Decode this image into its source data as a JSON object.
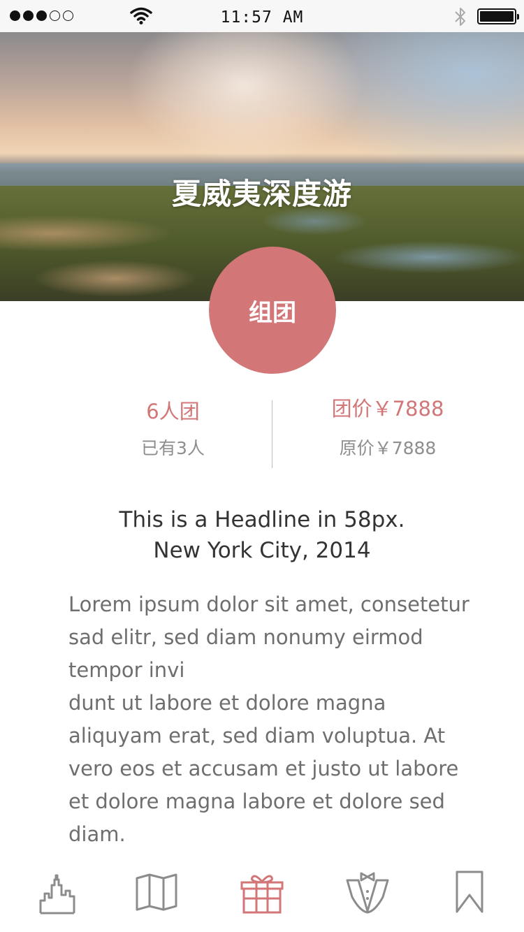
{
  "status_bar": {
    "signal_dots_filled": 3,
    "signal_dots_total": 5,
    "time": "11:57 AM",
    "wifi_icon": "wifi-icon",
    "bluetooth_icon": "bluetooth-icon",
    "battery_level": 1.0
  },
  "hero": {
    "title": "夏威夷深度游"
  },
  "join_button": {
    "label": "组团"
  },
  "stats": {
    "group_size": "6人团",
    "joined": "已有3人",
    "group_price": "团价￥7888",
    "original_price": "原价￥7888"
  },
  "headline": {
    "line1": "This is a Headline in 58px.",
    "line2": "New York City, 2014"
  },
  "body": {
    "lines": [
      "Lorem ipsum dolor sit amet, consetetur",
      "sad elitr, sed diam nonumy eirmod",
      "tempor invi",
      "dunt ut labore et dolore magna",
      "aliquyam erat, sed diam voluptua. At",
      "vero eos et accusam et justo ut labore",
      "et dolore magna labore et dolore sed",
      "diam."
    ]
  },
  "tab_bar": {
    "tabs": [
      {
        "icon": "city-icon",
        "active": false
      },
      {
        "icon": "map-icon",
        "active": false
      },
      {
        "icon": "gift-icon",
        "active": true
      },
      {
        "icon": "tuxedo-icon",
        "active": false
      },
      {
        "icon": "bookmark-icon",
        "active": false
      }
    ]
  },
  "colors": {
    "accent": "#d27677",
    "inactive_icon": "#8c8c8c",
    "body_text": "#6e6e6e",
    "headline_text": "#333333"
  }
}
